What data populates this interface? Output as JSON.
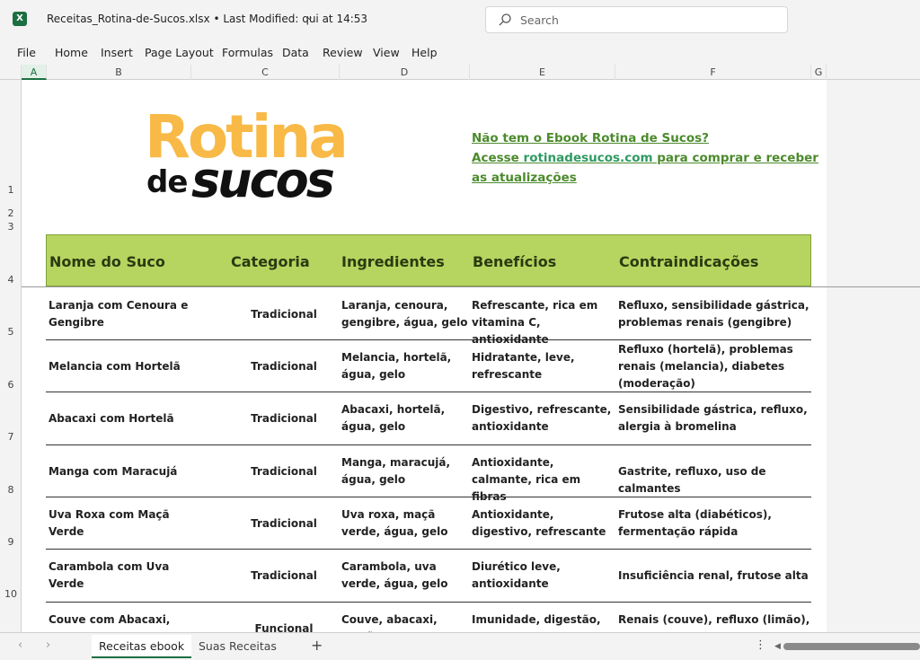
{
  "app": {
    "icon_text": "X",
    "file_title": "Receitas_Rotina-de-Sucos.xlsx • Last Modified: qui at 14:53",
    "search_placeholder": "Search"
  },
  "menu": [
    "File",
    "Home",
    "Insert",
    "Page Layout",
    "Formulas",
    "Data",
    "Review",
    "View",
    "Help"
  ],
  "columns": [
    "A",
    "B",
    "C",
    "D",
    "E",
    "F",
    "G"
  ],
  "rows": [
    "1",
    "2",
    "3",
    "4",
    "5",
    "6",
    "7",
    "8",
    "9",
    "10"
  ],
  "logo": {
    "rotina": "Rotina",
    "de": "de",
    "sucos": "sucos"
  },
  "promo": {
    "line1": "Não tem o Ebook Rotina de Sucos?",
    "line2a": "Acesse ",
    "link": "rotinadesucos.com",
    "line2b": " para comprar e receber as atualizações"
  },
  "table": {
    "headers": [
      "Nome do Suco",
      "Categoria",
      "Ingredientes",
      "Benefícios",
      "Contraindicações"
    ],
    "rows": [
      [
        "Laranja com Cenoura e Gengibre",
        "Tradicional",
        "Laranja, cenoura, gengibre, água, gelo",
        "Refrescante, rica em vitamina C, antioxidante",
        "Refluxo, sensibilidade gástrica, problemas renais (gengibre)"
      ],
      [
        "Melancia com Hortelã",
        "Tradicional",
        "Melancia, hortelã, água, gelo",
        "Hidratante, leve, refrescante",
        "Refluxo (hortelã), problemas renais (melancia), diabetes (moderação)"
      ],
      [
        "Abacaxi com Hortelã",
        "Tradicional",
        "Abacaxi, hortelã, água, gelo",
        "Digestivo, refrescante, antioxidante",
        "Sensibilidade gástrica, refluxo, alergia à bromelina"
      ],
      [
        "Manga com Maracujá",
        "Tradicional",
        "Manga, maracujá, água, gelo",
        "Antioxidante, calmante, rica em fibras",
        "Gastrite, refluxo, uso de calmantes"
      ],
      [
        "Uva Roxa com Maçã Verde",
        "Tradicional",
        "Uva roxa, maçã verde, água, gelo",
        "Antioxidante, digestivo, refrescante",
        "Frutose alta (diabéticos), fermentação rápida"
      ],
      [
        "Carambola com Uva Verde",
        "Tradicional",
        "Carambola, uva verde, água, gelo",
        "Diurético leve, antioxidante",
        "Insuficiência renal, frutose alta"
      ],
      [
        "Couve com Abacaxi,",
        "Funcional",
        "Couve, abacaxi, maçã,",
        "Imunidade, digestão,",
        "Renais (couve), refluxo (limão),"
      ]
    ]
  },
  "tabs": [
    "Receitas ebook",
    "Suas Receitas"
  ]
}
